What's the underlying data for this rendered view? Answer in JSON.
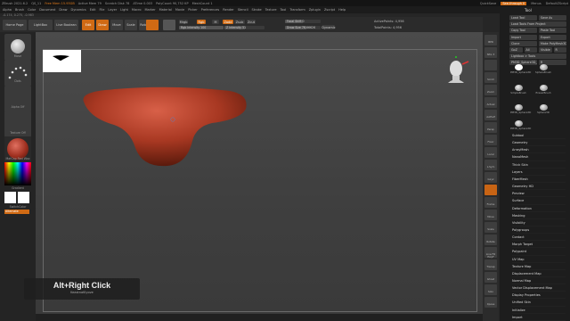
{
  "titlebar": {
    "app": "ZBrush 2021.6.2",
    "items": [
      "QS_11",
      "Free Mem 15.93GB",
      "Active Mem 79",
      "Scratch Disk 78",
      "ATime 0.003",
      "PolyCount 90,752 KP",
      "MeshCount 1"
    ],
    "right": [
      "QuickSave",
      "See-through 0",
      "Menus",
      "DefaultZScript"
    ]
  },
  "menubar": [
    "Alpha",
    "Brush",
    "Color",
    "Document",
    "Draw",
    "Dynamics",
    "Edit",
    "File",
    "Layer",
    "Light",
    "Macro",
    "Marker",
    "Material",
    "Movie",
    "Picker",
    "Preferences",
    "Render",
    "Stencil",
    "Stroke",
    "Texture",
    "Tool",
    "Transform",
    "Zplugin",
    "Zscript",
    "Help"
  ],
  "coords": "-0.174, 0.275, -0.983",
  "toolbar": {
    "home": "Home Page",
    "lightbox": "LightBox",
    "live": "Live Boolean",
    "edit": "Edit",
    "draw": "Draw",
    "move": "Move",
    "scale": "Scale",
    "rotate": "Rotate",
    "mrgb": "Mrgb",
    "rgb": "Rgb",
    "m": "M",
    "zadd": "Zadd",
    "zsub": "Zsub",
    "zcut": "Zcut",
    "rgb_intensity": "Rgb Intensity 100",
    "z_intensity": "Z Intensity 51",
    "focal_shift": "Focal Shift 0",
    "draw_size": "Draw Size 76.66626",
    "dynamic": "Dynamic",
    "active_points": "ActivePoints: 4,956",
    "total_points": "TotalPoints: 4,956"
  },
  "left": {
    "move": "Move",
    "dots": "Dots",
    "alpha": "Alpha Off",
    "texture": "Texture Off",
    "material": "MatCap Red Wax",
    "gradient": "Gradient",
    "switch": "SwitchColor",
    "alternate": "Alternate"
  },
  "hint": {
    "title": "Alt+Right Click",
    "subtitle": "KeastnaKlyove"
  },
  "toolpanel": {
    "title": "Tool",
    "rows": [
      [
        "Load Tool",
        "Save As"
      ],
      [
        "Load Tools From Project"
      ],
      [
        "Copy Tool",
        "Paste Tool"
      ],
      [
        "Import",
        "Export"
      ],
      [
        "Clone",
        "Make PolyMesh3D"
      ],
      [
        "GoZ",
        "All",
        "Visible",
        "R"
      ],
      [
        "Lightbox > Tools"
      ],
      [
        "PM3D_Sphere3D_1",
        "R"
      ]
    ],
    "meshes": [
      "PM3D_Sphere3D",
      "SphereBrush",
      "SimpleBrush",
      "EraserBrush",
      "PM3D_Sphere3D",
      "Sphere3D",
      "PM3D_Sphere3D"
    ],
    "items": [
      "Subtool",
      "Geometry",
      "ArrayMesh",
      "NanoMesh",
      "Thick Skin",
      "Layers",
      "FiberMesh",
      "Geometry HD",
      "Preview",
      "Surface",
      "Deformation",
      "Masking",
      "Visibility",
      "Polygroups",
      "Contact",
      "Morph Target",
      "Polypaint",
      "UV Map",
      "Texture Map",
      "Displacement Map",
      "Normal Map",
      "Vector Displacement Map",
      "Display Properties",
      "Unified Skin",
      "Initialize",
      "Import"
    ]
  },
  "righttools": [
    "BPR",
    "SPix 3",
    "",
    "Scroll",
    "Zoom",
    "Actual",
    "AAHalf",
    "Persp",
    "Floor",
    "Local",
    "L.Sym",
    "Gxyz",
    "",
    "Frame",
    "Move",
    "Scale",
    "Rotate",
    "Line Fill PolyF",
    "Transp",
    "Ghost",
    "Solo",
    "Xpose"
  ],
  "colors": {
    "accent": "#d06a14",
    "mesh": "#b5402a"
  }
}
